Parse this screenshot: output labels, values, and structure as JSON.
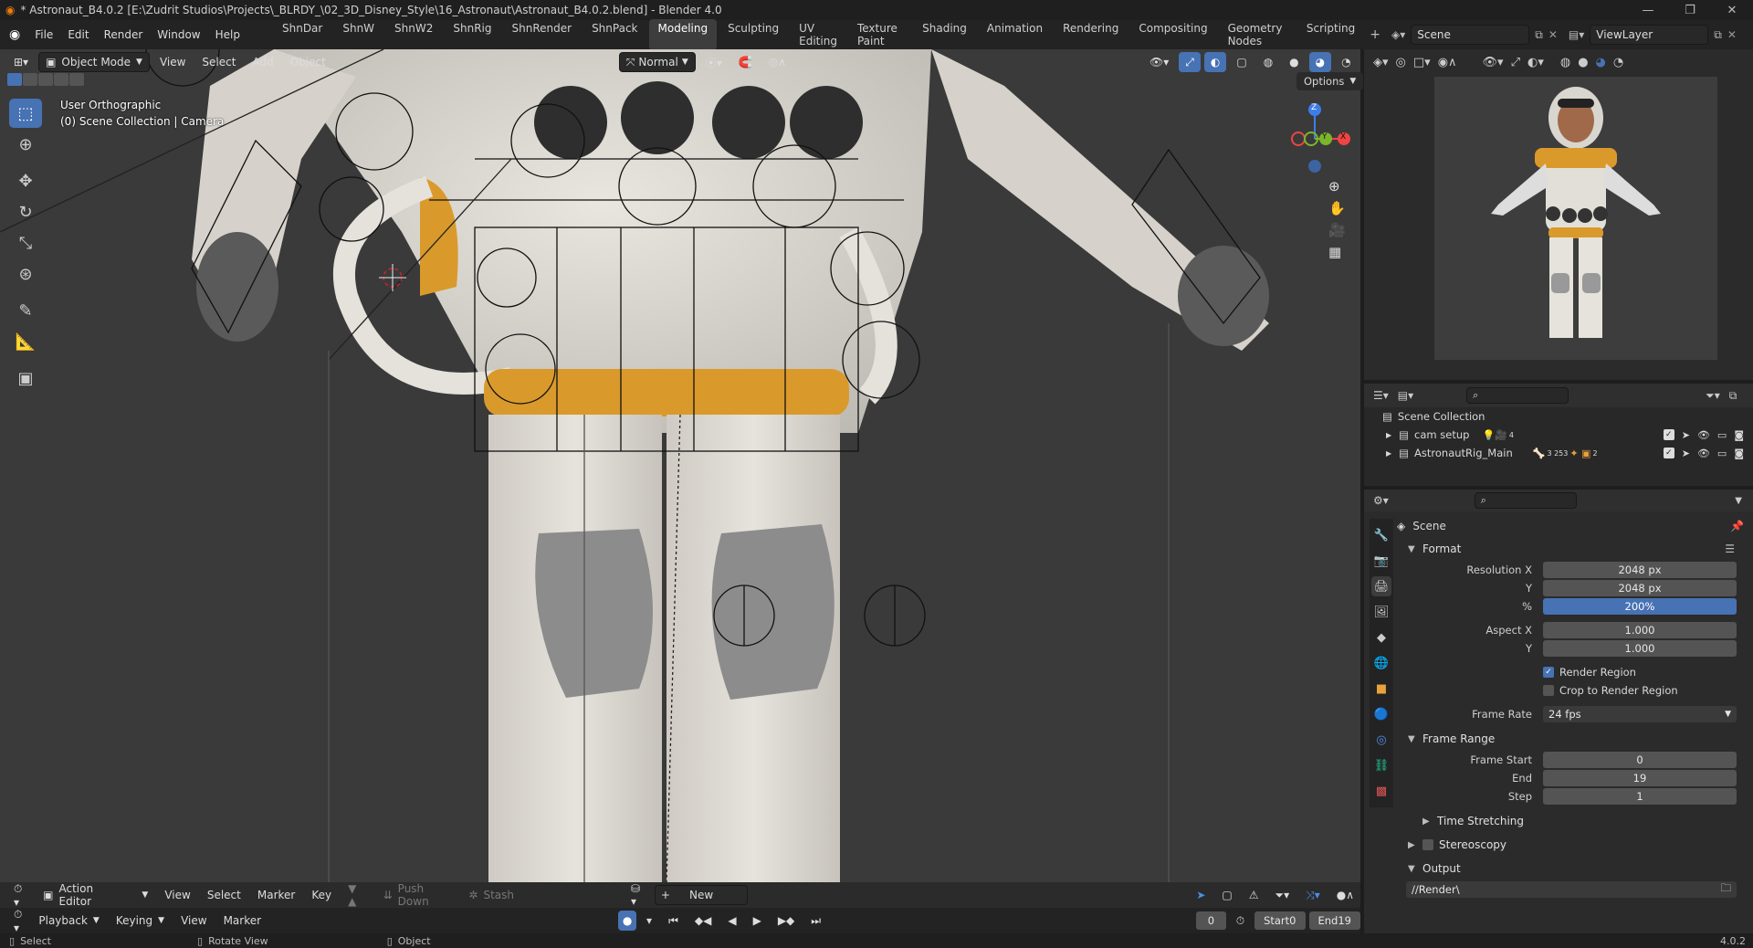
{
  "titlebar": {
    "text": "* Astronaut_B4.0.2 [E:\\Zudrit Studios\\Projects\\_BLRDY_\\02_3D_Disney_Style\\16_Astronaut\\Astronaut_B4.0.2.blend] - Blender 4.0"
  },
  "menu": [
    "File",
    "Edit",
    "Render",
    "Window",
    "Help"
  ],
  "workspaces": [
    {
      "label": "ShnDar",
      "active": false
    },
    {
      "label": "ShnW",
      "active": false
    },
    {
      "label": "ShnW2",
      "active": false
    },
    {
      "label": "ShnRig",
      "active": false
    },
    {
      "label": "ShnRender",
      "active": false
    },
    {
      "label": "ShnPack",
      "active": false
    },
    {
      "label": "Modeling",
      "active": true
    },
    {
      "label": "Sculpting",
      "active": false
    },
    {
      "label": "UV Editing",
      "active": false
    },
    {
      "label": "Texture Paint",
      "active": false
    },
    {
      "label": "Shading",
      "active": false
    },
    {
      "label": "Animation",
      "active": false
    },
    {
      "label": "Rendering",
      "active": false
    },
    {
      "label": "Compositing",
      "active": false
    },
    {
      "label": "Geometry Nodes",
      "active": false
    },
    {
      "label": "Scripting",
      "active": false
    }
  ],
  "scene_field": "Scene",
  "viewlayer_field": "ViewLayer",
  "viewport": {
    "mode": "Object Mode",
    "menus": [
      "View",
      "Select",
      "Add",
      "Object"
    ],
    "orientation": "Normal",
    "options": "Options",
    "view_name": "User Orthographic",
    "collection_info": "(0) Scene Collection | Camera",
    "gizmo_axes": {
      "z": "Z",
      "y": "Y",
      "x": "X"
    }
  },
  "outliner": {
    "root": "Scene Collection",
    "items": [
      {
        "label": "cam setup",
        "extra": "4"
      },
      {
        "label": "AstronautRig_Main",
        "extra": "3 253",
        "extra2": "2"
      }
    ]
  },
  "properties": {
    "title": "Scene",
    "format": {
      "header": "Format",
      "res_x_label": "Resolution X",
      "res_x": "2048 px",
      "res_y_label": "Y",
      "res_y": "2048 px",
      "pct_label": "%",
      "pct": "200%",
      "asp_x_label": "Aspect X",
      "asp_x": "1.000",
      "asp_y_label": "Y",
      "asp_y": "1.000",
      "render_region": "Render Region",
      "crop_region": "Crop to Render Region",
      "frame_rate_label": "Frame Rate",
      "frame_rate": "24 fps"
    },
    "frame_range": {
      "header": "Frame Range",
      "start_label": "Frame Start",
      "start": "0",
      "end_label": "End",
      "end": "19",
      "step_label": "Step",
      "step": "1"
    },
    "time_stretching": "Time Stretching",
    "stereoscopy": "Stereoscopy",
    "output": {
      "header": "Output",
      "path": "//Render\\"
    }
  },
  "action_editor": {
    "mode": "Action Editor",
    "menus": [
      "View",
      "Select",
      "Marker",
      "Key"
    ],
    "push_down": "Push Down",
    "stash": "Stash",
    "new": "New"
  },
  "timeline": {
    "playback": "Playback",
    "keying": "Keying",
    "view": "View",
    "marker": "Marker",
    "current_frame": "0",
    "start_label": "Start",
    "start": "0",
    "end_label": "End",
    "end": "19"
  },
  "statusbar": {
    "select": "Select",
    "rotate": "Rotate View",
    "object": "Object",
    "version": "4.0.2"
  },
  "colors": {
    "accent": "#4772b3",
    "suit": "#d9d6cf",
    "orange": "#d99a2b",
    "viewport_bg": "#3a3a3a"
  }
}
